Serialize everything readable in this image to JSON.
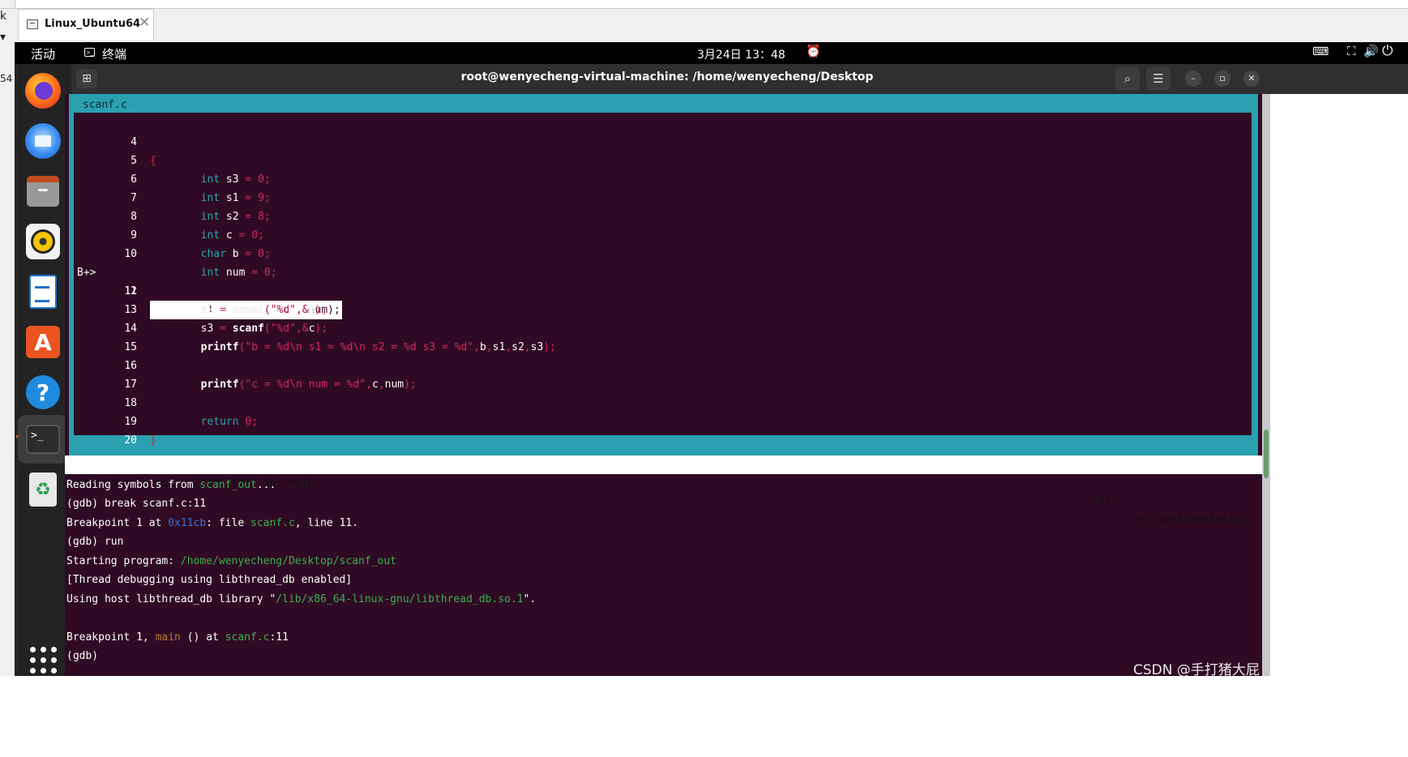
{
  "vm": {
    "tab_label": "Linux_Ubuntu64",
    "left_glyphs": [
      "k",
      "▾",
      "54"
    ]
  },
  "topbar": {
    "activities": "活动",
    "app_label": "终端",
    "clock": "3月24日  13：48"
  },
  "terminal": {
    "title": "root@wenyecheng-virtual-machine: /home/wenyecheng/Desktop"
  },
  "source": {
    "filename": "scanf.c",
    "current_marker": "B+>",
    "lines": [
      {
        "n": "4"
      },
      {
        "n": "5"
      },
      {
        "n": "6"
      },
      {
        "n": "7"
      },
      {
        "n": "8"
      },
      {
        "n": "9"
      },
      {
        "n": "10"
      },
      {
        "n": "11"
      },
      {
        "n": "12"
      },
      {
        "n": "13"
      },
      {
        "n": "14"
      },
      {
        "n": "15"
      },
      {
        "n": "16"
      },
      {
        "n": "17"
      },
      {
        "n": "18"
      },
      {
        "n": "19"
      },
      {
        "n": "20"
      }
    ]
  },
  "status": {
    "left": "multi-thre Thread 0x7ffff7fa97 In: main",
    "line": "L11",
    "pc": "PC: 0x5555555551cb"
  },
  "gdb": {
    "l1_a": "Reading symbols from ",
    "l1_b": "scanf_out",
    "l1_c": "...",
    "l2": "(gdb) break scanf.c:11",
    "l3_a": "Breakpoint 1 at ",
    "l3_b": "0x11cb",
    "l3_c": ": file ",
    "l3_d": "scanf.c",
    "l3_e": ", line 11.",
    "l4": "(gdb) run",
    "l5_a": "Starting program: ",
    "l5_b": "/home/wenyecheng/Desktop/scanf_out",
    "l6": "[Thread debugging using libthread_db enabled]",
    "l7_a": "Using host libthread_db library \"",
    "l7_b": "/lib/x86_64-linux-gnu/libthread_db.so.1",
    "l7_c": "\".",
    "l8_a": "Breakpoint 1, ",
    "l8_b": "main",
    "l8_c": " () at ",
    "l8_d": "scanf.c",
    "l8_e": ":11",
    "l9": "(gdb)"
  },
  "watermark": "CSDN @手打猪大屁",
  "colors": {
    "terminal_bg": "#300a24",
    "tui_border": "#2aa0b0",
    "keyword": "#2aa0b0",
    "string": "#d12b5e",
    "path_green": "#39b04f"
  }
}
